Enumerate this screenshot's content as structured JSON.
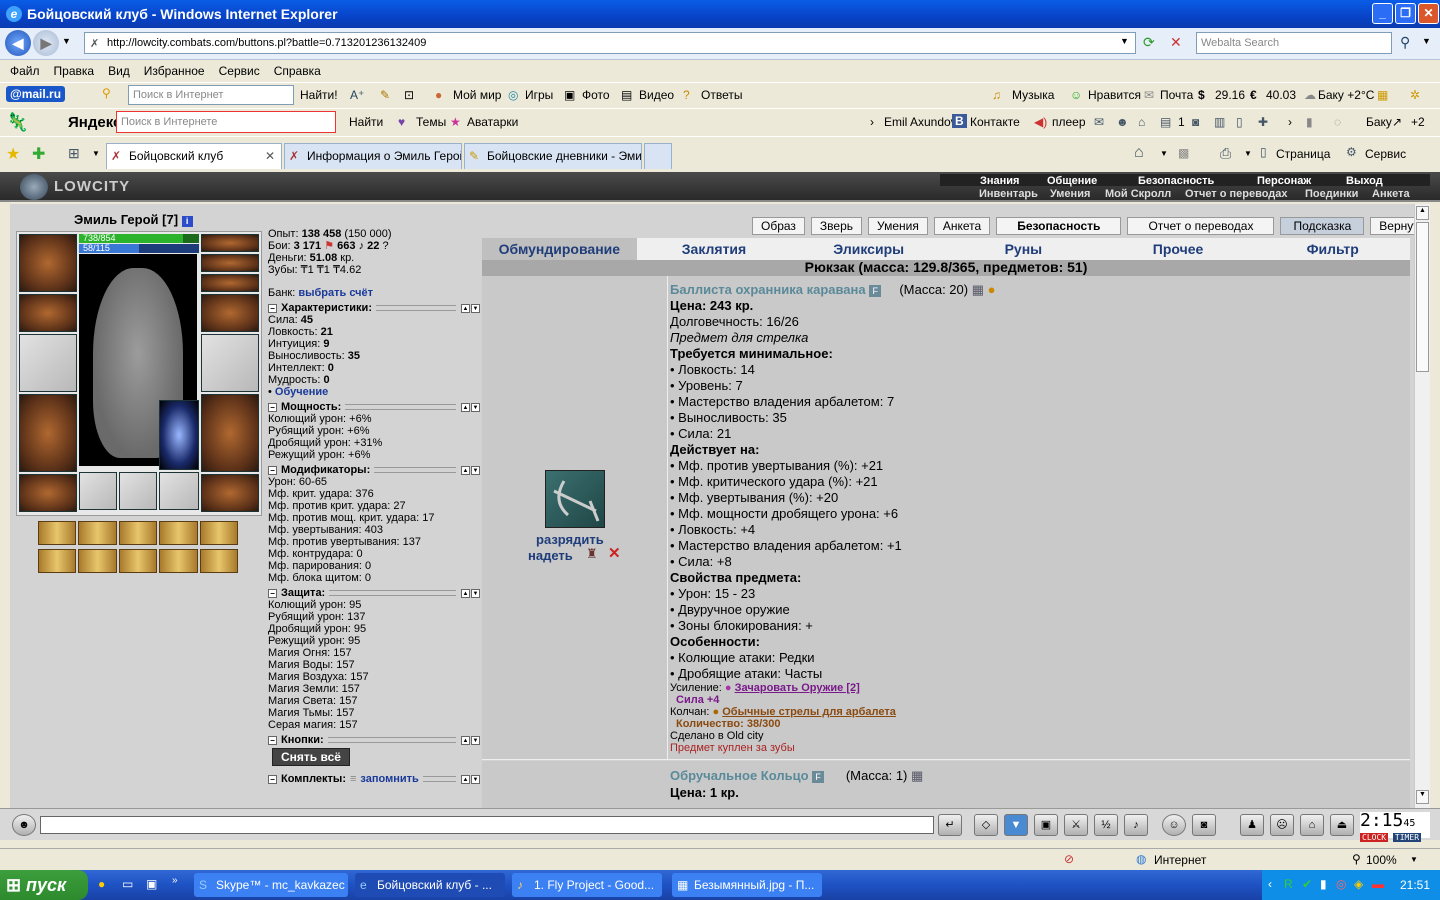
{
  "window": {
    "title": "Бойцовский клуб - Windows Internet Explorer"
  },
  "address": {
    "url": "http://lowcity.combats.com/buttons.pl?battle=0.713201236132409",
    "search_placeholder": "Webalta Search"
  },
  "menu": [
    "Файл",
    "Правка",
    "Вид",
    "Избранное",
    "Сервис",
    "Справка"
  ],
  "mailbar": {
    "logo": "@mail.ru",
    "search_placeholder": "Поиск в Интернет",
    "find": "Найти!",
    "items": [
      "Мой мир",
      "Игры",
      "Фото",
      "Видео",
      "Ответы"
    ],
    "right": [
      "Музыка",
      "Нравится",
      "Почта"
    ],
    "usd": "29.16",
    "eur": "40.03",
    "weather": "Баку +2°C"
  },
  "yandexbar": {
    "logo": "Яндекс",
    "search_placeholder": "Поиск в Интернете",
    "find": "Найти",
    "themes": "Темы",
    "avatars": "Аватарки",
    "user": "Emil Axundov",
    "vk": "Контакте",
    "player": "плеер",
    "count": "1",
    "city": "Баку",
    "plus": "+2"
  },
  "tabs": [
    {
      "label": "Бойцовский клуб"
    },
    {
      "label": "Информация о Эмиль Герой"
    },
    {
      "label": "Бойцовские дневники - Эми..."
    }
  ],
  "cmdbar": {
    "page": "Страница",
    "service": "Сервис"
  },
  "game": {
    "logo": "LOWCITY",
    "top_menu": [
      "Знания",
      "Общение",
      "Безопасность",
      "Персонаж",
      "Выход"
    ],
    "sub_menu": [
      "Инвентарь",
      "Умения",
      "Мой Скролл",
      "Отчет о переводах",
      "Поединки",
      "Анкета"
    ],
    "char_name": "Эмиль Герой",
    "char_level": "[7]",
    "hp": "738/854",
    "hp_frac": 0.864,
    "mana": "58/115",
    "mana_frac": 0.504,
    "stats": {
      "exp_label": "Опыт:",
      "exp": "138 458",
      "exp_next": "(150 000)",
      "fights_label": "Бои:",
      "wins": "3 171",
      "losses": "663",
      "draws": "22",
      "money_label": "Деньги:",
      "money": "51.08",
      "money_unit": "кр.",
      "teeth_label": "Зубы:",
      "teeth": "₸1 ₸1 ₸4.62",
      "bank_label": "Банк:",
      "bank_link": "выбрать счёт"
    },
    "sections": {
      "chars": "Характеристики:",
      "power": "Мощность:",
      "mods": "Модификаторы:",
      "defense": "Защита:",
      "buttons": "Кнопки:",
      "sets": "Комплекты:"
    },
    "char_lines": [
      {
        "k": "Сила:",
        "v": "45"
      },
      {
        "k": "Ловкость:",
        "v": "21"
      },
      {
        "k": "Интуиция:",
        "v": "9"
      },
      {
        "k": "Выносливость:",
        "v": "35"
      },
      {
        "k": "Интеллект:",
        "v": "0"
      },
      {
        "k": "Мудрость:",
        "v": "0"
      }
    ],
    "training": "Обучение",
    "power_lines": [
      "Колющий урон: +6%",
      "Рубящий урон: +6%",
      "Дробящий урон: +31%",
      "Режущий урон: +6%"
    ],
    "mod_lines": [
      "Урон: 60-65",
      "Мф. крит. удара: 376",
      "Мф. против крит. удара: 27",
      "Мф. против мощ. крит. удара: 17",
      "Мф. увертывания: 403",
      "Мф. против увертывания: 137",
      "Мф. контрудара: 0",
      "Мф. парирования: 0",
      "Мф. блока щитом: 0"
    ],
    "def_lines": [
      "Колющий урон: 95",
      "Рубящий урон: 137",
      "Дробящий урон: 95",
      "Режущий урон: 95",
      "Магия Огня: 157",
      "Магия Воды: 157",
      "Магия Воздуха: 157",
      "Магия Земли: 157",
      "Магия Света: 157",
      "Магия Тьмы: 157",
      "Серая магия: 157"
    ],
    "undress_all": "Снять всё",
    "remember": "запомнить",
    "buttons": [
      "Образ",
      "Зверь",
      "Умения",
      "Анкета",
      "Безопасность",
      "Отчет о переводах",
      "Подсказка",
      "Вернуться"
    ],
    "inv_tabs": [
      "Обмундирование",
      "Заклятия",
      "Эликсиры",
      "Руны",
      "Прочее",
      "Фильтр"
    ],
    "backpack": "Рюкзак (масса: 129.8/365, предметов: 51)",
    "item": {
      "unload": "разрядить",
      "equip": "надеть",
      "name": "Баллиста охранника каравана",
      "mass": "(Масса: 20)",
      "price": "Цена: 243 кр.",
      "durability": "Долговечность: 16/26",
      "for_class": "Предмет для стрелка",
      "req_title": "Требуется минимальное:",
      "req": [
        "• Ловкость: 14",
        "• Уровень: 7",
        "• Мастерство владения арбалетом: 7",
        "• Выносливость: 35",
        "• Сила: 21"
      ],
      "acts_title": "Действует на:",
      "acts": [
        "• Мф. против увертывания (%): +21",
        "• Мф. критического удара (%): +21",
        "• Мф. увертывания (%): +20",
        "• Мф. мощности дробящего урона: +6",
        "• Ловкость: +4",
        "• Мастерство владения арбалетом: +1",
        "• Сила: +8"
      ],
      "props_title": "Свойства предмета:",
      "props": [
        "• Урон: 15 - 23",
        "• Двуручное оружие",
        "• Зоны блокирования: +"
      ],
      "feat_title": "Особенности:",
      "feats": [
        "• Колющие атаки: Редки",
        "• Дробящие атаки: Часты"
      ],
      "boost_label": "Усиление:",
      "boost_link": "Зачаровать Оружие [2]",
      "boost_val": "Сила +4",
      "quiver_label": "Колчан:",
      "quiver_link": "Обычные стрелы для арбалета",
      "quiver_qty": "Количество: 38/300",
      "made_in": "Сделано в Old city",
      "bought": "Предмет куплен за зубы"
    },
    "item2": {
      "name": "Обручальное Кольцо",
      "mass": "(Масса: 1)",
      "price": "Цена: 1 кр."
    }
  },
  "clock": {
    "time": "2:15",
    "sec": "45",
    "label1": "CLOCK",
    "label2": "TIMER"
  },
  "status": {
    "zone": "Интернет",
    "zoom": "100%"
  },
  "taskbar": {
    "start": "пуск",
    "tasks": [
      "Skype™ - mc_kavkazec",
      "Бойцовский клуб - ...",
      "1. Fly Project - Good...",
      "Безымянный.jpg - П..."
    ],
    "time": "21:51"
  }
}
